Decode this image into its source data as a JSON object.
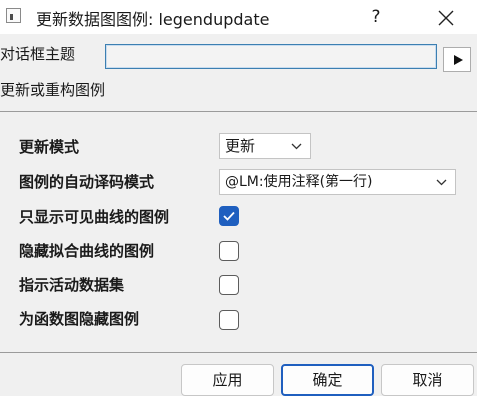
{
  "window": {
    "title": "更新数据图图例: legendupdate",
    "help_label": "?",
    "app_icon": "dialog-app-icon",
    "close_icon": "close-icon"
  },
  "theme": {
    "label": "对话框主题",
    "value": "",
    "arrow_icon": "triangle-right-icon"
  },
  "section": {
    "label": "更新或重构图例"
  },
  "options": {
    "update_mode": {
      "label": "更新模式",
      "selected": "更新"
    },
    "auto_translate": {
      "label": "图例的自动译码模式",
      "selected": "@LM:使用注释(第一行)"
    },
    "visible_only": {
      "label": "只显示可见曲线的图例",
      "checked": true
    },
    "hide_fit": {
      "label": "隐藏拟合曲线的图例",
      "checked": false
    },
    "active_dataset": {
      "label": "指示活动数据集",
      "checked": false
    },
    "hide_function": {
      "label": "为函数图隐藏图例",
      "checked": false
    }
  },
  "buttons": {
    "apply": "应用",
    "ok": "确定",
    "cancel": "取消"
  },
  "colors": {
    "accent": "#1f5fbf",
    "background": "#f0f0f0"
  }
}
